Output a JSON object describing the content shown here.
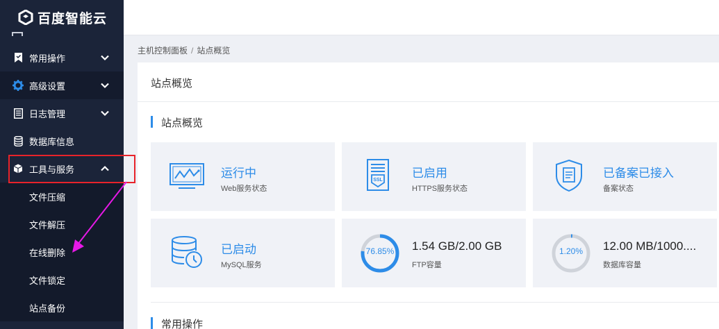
{
  "brand": {
    "name": "百度智能云"
  },
  "sidebar": {
    "items": [
      {
        "label": "常用操作",
        "icon": "bookmark-icon"
      },
      {
        "label": "高级设置",
        "icon": "gear-icon"
      },
      {
        "label": "日志管理",
        "icon": "log-icon"
      },
      {
        "label": "数据库信息",
        "icon": "database-icon"
      },
      {
        "label": "工具与服务",
        "icon": "cube-icon"
      }
    ],
    "sub_items": [
      {
        "label": "文件压缩"
      },
      {
        "label": "文件解压"
      },
      {
        "label": "在线删除"
      },
      {
        "label": "文件锁定"
      },
      {
        "label": "站点备份"
      }
    ]
  },
  "breadcrumb": {
    "root": "主机控制面板",
    "sep": "/",
    "current": "站点概览"
  },
  "panel": {
    "title": "站点概览"
  },
  "sections": {
    "overview": "站点概览",
    "common": "常用操作"
  },
  "cards": [
    {
      "main": "运行中",
      "sub": "Web服务状态",
      "icon": "monitor-icon"
    },
    {
      "main": "已启用",
      "sub": "HTTPS服务状态",
      "icon": "ssl-certificate-icon"
    },
    {
      "main": "已备案已接入",
      "sub": "备案状态",
      "icon": "shield-document-icon"
    },
    {
      "main": "已启动",
      "sub": "MySQL服务",
      "icon": "database-clock-icon"
    },
    {
      "main": "1.54 GB/2.00 GB",
      "sub": "FTP容量",
      "ring": "76.85%",
      "ring_value": 0.7685
    },
    {
      "main": "12.00 MB/1000....",
      "sub": "数据库容量",
      "ring": "1.20%",
      "ring_value": 0.012
    }
  ],
  "colors": {
    "accent": "#2d8ce8",
    "sidebar_bg": "#1b2439",
    "highlight": "#e8232a",
    "arrow": "#e619e6"
  }
}
